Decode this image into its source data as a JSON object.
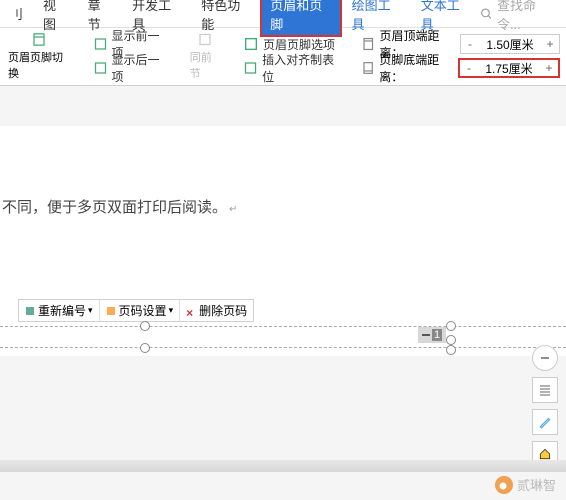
{
  "menu": {
    "items": [
      "刂",
      "视图",
      "章节",
      "开发工具",
      "特色功能",
      "页眉和页脚",
      "绘图工具",
      "文本工具"
    ],
    "active_index": 5,
    "search_placeholder": "查找命令..."
  },
  "ribbon": {
    "switch_label": "页眉页脚切换",
    "show_prev": "显示前一项",
    "show_next": "显示后一项",
    "same_prev": "同前节",
    "options": "页眉页脚选项",
    "insert_align": "插入对齐制表位",
    "header_dist_label": "页眉顶端距离：",
    "footer_dist_label": "页脚底端距离：",
    "header_dist_val": "1.50厘米",
    "footer_dist_val": "1.75厘米"
  },
  "doc": {
    "line": "不同，便于多页双面打印后阅读。"
  },
  "pagenum_toolbar": {
    "renumber": "重新编号",
    "settings": "页码设置",
    "delete": "删除页码"
  },
  "pagenum": "1",
  "watermark": "贰琳智"
}
